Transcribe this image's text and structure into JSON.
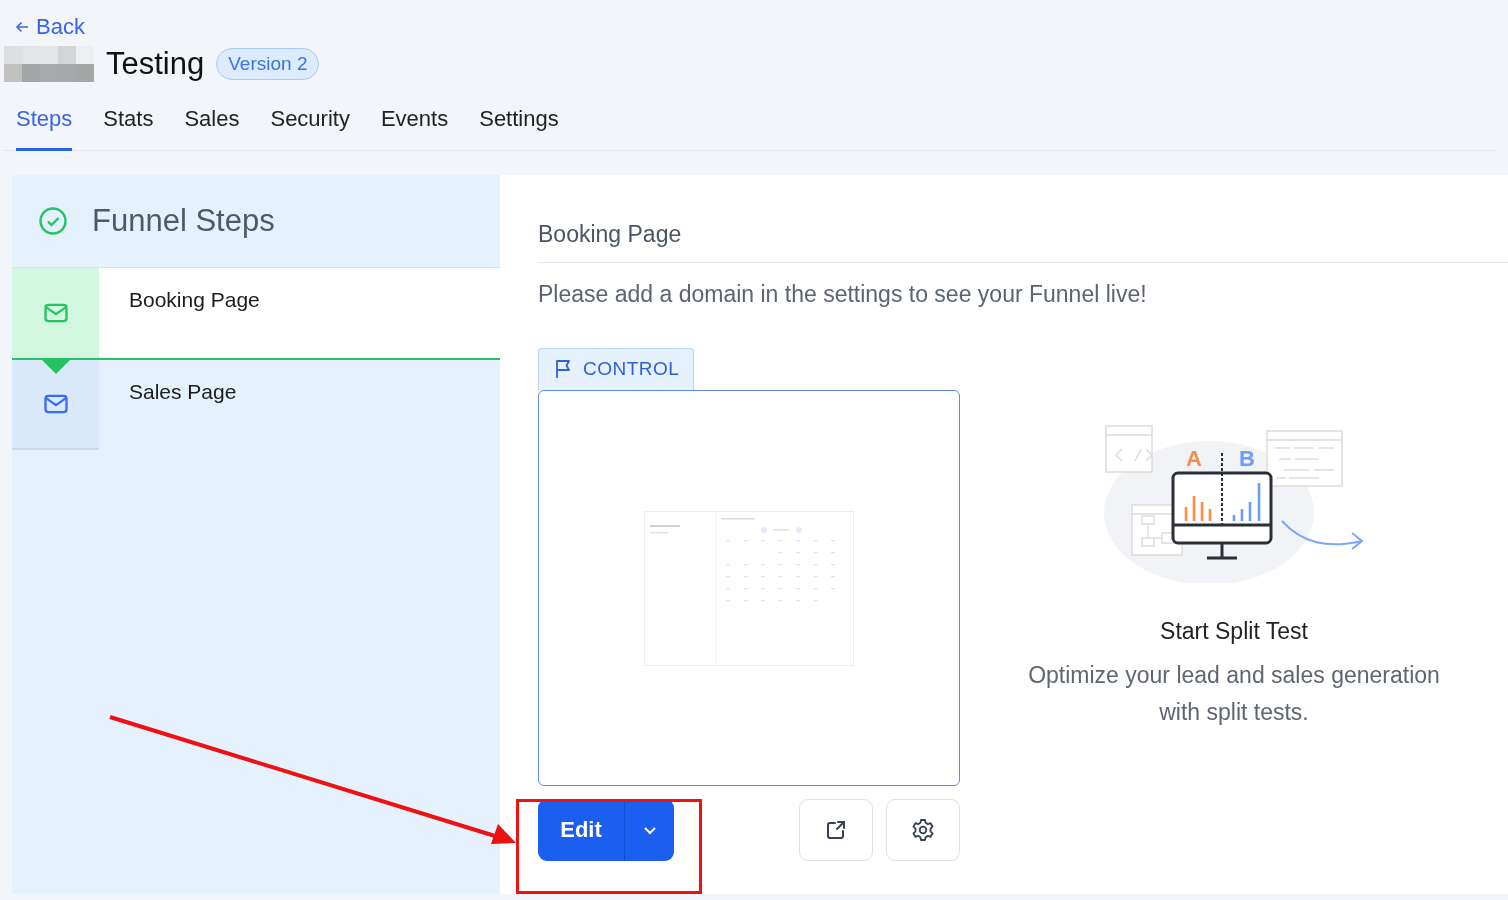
{
  "header": {
    "back_link": "Back",
    "title": "Testing",
    "version_badge": "Version 2"
  },
  "tabs": [
    {
      "label": "Steps",
      "selected": true
    },
    {
      "label": "Stats",
      "selected": false
    },
    {
      "label": "Sales",
      "selected": false
    },
    {
      "label": "Security",
      "selected": false
    },
    {
      "label": "Events",
      "selected": false
    },
    {
      "label": "Settings",
      "selected": false
    }
  ],
  "funnel_steps": {
    "title": "Funnel Steps",
    "steps": [
      {
        "name": "Booking Page",
        "selected": true
      },
      {
        "name": "Sales Page",
        "selected": false
      }
    ]
  },
  "step_detail": {
    "title": "Booking Page",
    "notice": "Please add a domain in the settings to see your Funnel live!",
    "variant_tag": "CONTROL",
    "edit_button": "Edit"
  },
  "split_test": {
    "variant_labels": [
      "A",
      "B"
    ],
    "title": "Start Split Test",
    "description": "Optimize your lead and sales generation with split tests."
  }
}
